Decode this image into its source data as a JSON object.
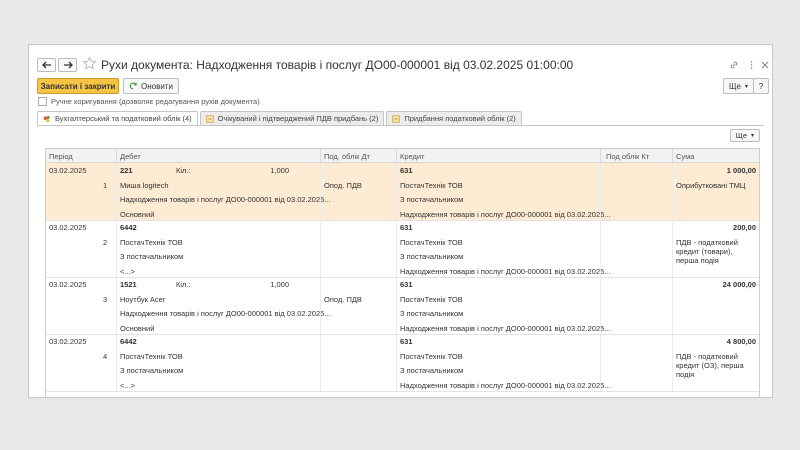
{
  "window": {
    "title": "Рухи документа: Надходження товарів і послуг ДО00-000001 від 03.02.2025 01:00:00",
    "link_icon": "link-icon",
    "menu_icon": "kebab-icon",
    "close_icon": "close-icon"
  },
  "toolbar": {
    "save_close_label": "Записати і закрити",
    "refresh_label": "Оновити",
    "more_label": "Ще",
    "help_label": "?"
  },
  "manual_correction": {
    "label": "Ручне коригування (дозволяє редагування рухів документа)",
    "checked": false
  },
  "tabs": [
    {
      "label": "Бухгалтерський та податковий облік (4)",
      "active": true
    },
    {
      "label": "Очікуваний і підтверджений ПДВ придбань (2)",
      "active": false
    },
    {
      "label": "Придбання податковий облік (2)",
      "active": false
    }
  ],
  "grid": {
    "more_label": "Ще",
    "headers": {
      "period": "Період",
      "debit": "Дебет",
      "tax_debit": "Под. облік Дт",
      "credit": "Кредит",
      "tax_credit": "Под облік Кт",
      "amount": "Сума"
    },
    "rows": [
      {
        "period": "03.02.2025",
        "num": "1",
        "selected": true,
        "debit_account": "221",
        "qty_label": "Кіл.:",
        "qty": "1,000",
        "debit_sub": [
          "Миша logitech",
          "Надходження товарів і послуг ДО00-000001 від 03.02.2025...",
          "Основний"
        ],
        "tax_debit": "Опод. ПДВ",
        "credit_account": "631",
        "credit_sub": [
          "ПостачТехнік ТОВ",
          "З постачальником",
          "Надходження товарів і послуг ДО00-000001 від 03.02.2025..."
        ],
        "amount": "1 000,00",
        "amount_note": "Оприбутковані ТМЦ"
      },
      {
        "period": "03.02.2025",
        "num": "2",
        "selected": false,
        "debit_account": "6442",
        "qty_label": "",
        "qty": "",
        "debit_sub": [
          "ПостачТехнік ТОВ",
          "З постачальником",
          "<...>"
        ],
        "tax_debit": "",
        "credit_account": "631",
        "credit_sub": [
          "ПостачТехнік ТОВ",
          "З постачальником",
          "Надходження товарів і послуг ДО00-000001 від 03.02.2025..."
        ],
        "amount": "200,00",
        "amount_note": "ПДВ - податковий кредит (товари), перша подія"
      },
      {
        "period": "03.02.2025",
        "num": "3",
        "selected": false,
        "debit_account": "1521",
        "qty_label": "Кіл.:",
        "qty": "1,000",
        "debit_sub": [
          "Ноутбук Acer",
          "Надходження товарів і послуг ДО00-000001 від 03.02.2025...",
          "Основний"
        ],
        "tax_debit": "Опод. ПДВ",
        "credit_account": "631",
        "credit_sub": [
          "ПостачТехнік ТОВ",
          "З постачальником",
          "Надходження товарів і послуг ДО00-000001 від 03.02.2025..."
        ],
        "amount": "24 000,00",
        "amount_note": ""
      },
      {
        "period": "03.02.2025",
        "num": "4",
        "selected": false,
        "debit_account": "6442",
        "qty_label": "",
        "qty": "",
        "debit_sub": [
          "ПостачТехнік ТОВ",
          "З постачальником",
          "<...>"
        ],
        "tax_debit": "",
        "credit_account": "631",
        "credit_sub": [
          "ПостачТехнік ТОВ",
          "З постачальником",
          "Надходження товарів і послуг ДО00-000001 від 03.02.2025..."
        ],
        "amount": "4 800,00",
        "amount_note": "ПДВ - податковий кредит (ОЗ), перша подія"
      }
    ]
  },
  "colors": {
    "primary_button": "#f6c445",
    "selected_row": "#fdecd3"
  }
}
